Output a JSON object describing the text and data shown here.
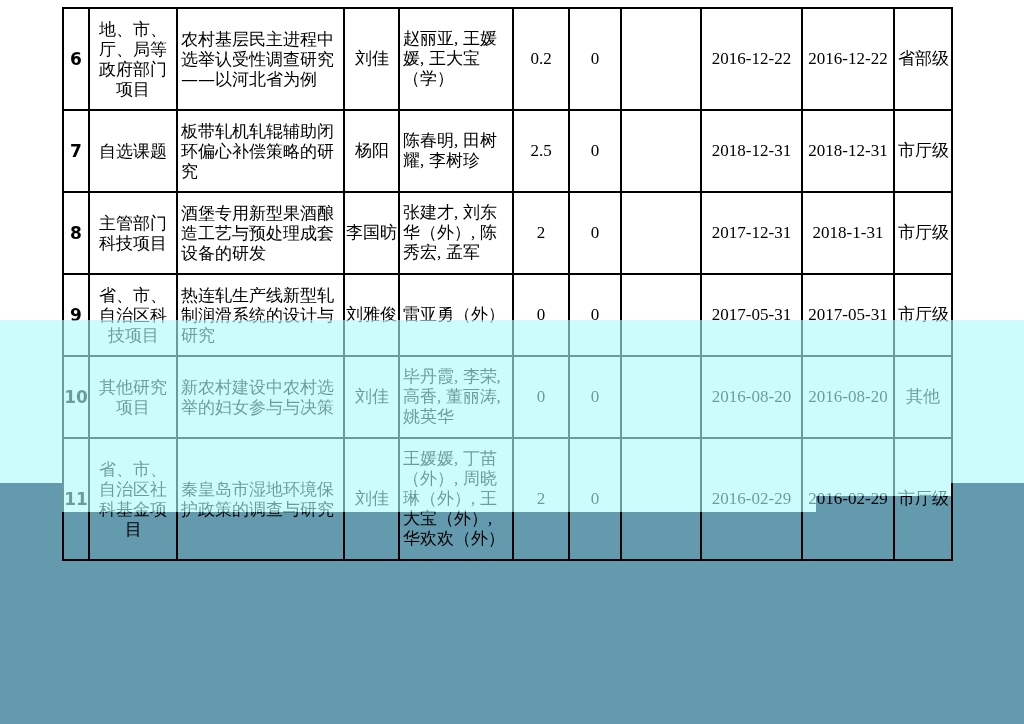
{
  "table": {
    "rows": [
      {
        "column_1": "6",
        "column_2": "地、市、厅、局等政府部门项目",
        "column_3": "农村基层民主进程中选举认受性调查研究——以河北省为例",
        "column_4": "刘佳",
        "column_5": "赵丽亚, 王媛媛, 王大宝（学）",
        "column_6": "0.2",
        "column_7": "0",
        "column_9": "2016-12-22",
        "column_10": "2016-12-22",
        "column_11": "省部级"
      },
      {
        "column_1": "7",
        "column_2": "自选课题",
        "column_3": "板带轧机轧辊辅助闭环偏心补偿策略的研究",
        "column_4": "杨阳",
        "column_5": "陈春明, 田树耀, 李树珍",
        "column_6": "2.5",
        "column_7": "0",
        "column_9": "2018-12-31",
        "column_10": "2018-12-31",
        "column_11": "市厅级"
      },
      {
        "column_1": "8",
        "column_2": "主管部门科技项目",
        "column_3": "酒堡专用新型果酒酿造工艺与预处理成套设备的研发",
        "column_4": "李国昉",
        "column_5": "张建才, 刘东华（外）, 陈秀宏, 孟军",
        "column_6": "2",
        "column_7": "0",
        "column_9": "2017-12-31",
        "column_10": "2018-1-31",
        "column_11": "市厅级"
      },
      {
        "column_1": "9",
        "column_2": "省、市、自治区科技项目",
        "column_3": "热连轧生产线新型轧制润滑系统的设计与研究",
        "column_4": "刘雅俊",
        "column_5": "雷亚勇（外）",
        "column_6": "0",
        "column_7": "0",
        "column_9": "2017-05-31",
        "column_10": "2017-05-31",
        "column_11": "市厅级"
      },
      {
        "column_1": "10",
        "column_2": "其他研究项目",
        "column_3": "新农村建设中农村选举的妇女参与与决策",
        "column_4": "刘佳",
        "column_5": "毕丹霞, 李荣, 高香, 董丽涛, 姚英华",
        "column_6": "0",
        "column_7": "0",
        "column_9": "2016-08-20",
        "column_10": "2016-08-20",
        "column_11": "其他"
      },
      {
        "column_1": "11",
        "column_2": "省、市、自治区社科基金项目",
        "column_3": "秦皇岛市湿地环境保护政策的调查与研究",
        "column_4": "刘佳",
        "column_5": "王媛媛, 丁苗（外）, 周晓琳（外）, 王大宝（外）, 华欢欢（外）",
        "column_6": "2",
        "column_7": "0",
        "column_9": "2016-02-29",
        "column_10": "2016-02-29",
        "column_11": "市厅级"
      }
    ]
  }
}
